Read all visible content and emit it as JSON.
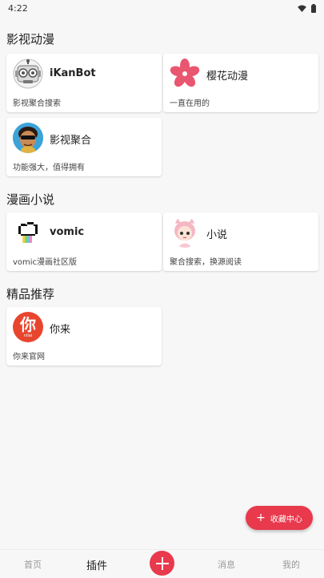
{
  "status_bar": {
    "time": "4:22"
  },
  "sections": [
    {
      "title": "影视动漫",
      "cards": [
        {
          "name": "iKanBot",
          "desc": "影视聚合搜索",
          "icon": "robot-icon"
        },
        {
          "name": "樱花动漫",
          "desc": "一直在用的",
          "icon": "sakura-flower-icon"
        },
        {
          "name": "影视聚合",
          "desc": "功能强大，值得拥有",
          "icon": "cartoon-avatar-icon"
        }
      ]
    },
    {
      "title": "漫画小说",
      "cards": [
        {
          "name": "vomic",
          "desc": "vomic漫画社区版",
          "icon": "pixel-cloud-icon"
        },
        {
          "name": "小说",
          "desc": "聚合搜索，换源阅读",
          "icon": "anime-girl-icon"
        }
      ]
    },
    {
      "title": "精品推荐",
      "cards": [
        {
          "name": "你来",
          "desc": "你来官网",
          "icon": "nilai-logo-icon",
          "logo_text": "你",
          "logo_subtext": "nilai"
        }
      ]
    }
  ],
  "fab": {
    "label": "收藏中心",
    "icon": "plus-icon"
  },
  "bottom_nav": {
    "items": [
      {
        "label": "首页",
        "active": false
      },
      {
        "label": "插件",
        "active": true
      },
      {
        "label": "消息",
        "active": false
      },
      {
        "label": "我的",
        "active": false
      }
    ]
  },
  "colors": {
    "accent": "#e8394d",
    "background": "#f7f7f7"
  }
}
